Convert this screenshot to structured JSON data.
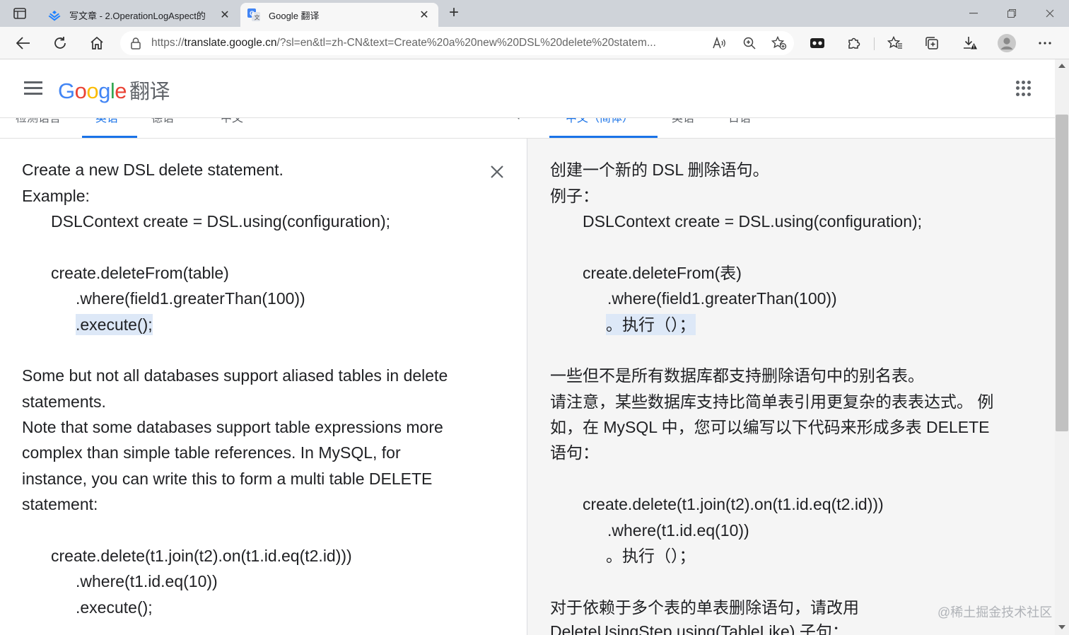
{
  "browser": {
    "tabs": [
      {
        "title": "写文章 - 2.OperationLogAspect的",
        "active": false
      },
      {
        "title": "Google 翻译",
        "active": true
      }
    ],
    "new_tab": "+",
    "url_prefix": "https://",
    "url_host": "translate.google.cn",
    "url_rest": "/?sl=en&tl=zh-CN&text=Create%20a%20new%20DSL%20delete%20statem..."
  },
  "header": {
    "logo": [
      "G",
      "o",
      "o",
      "g",
      "l",
      "e"
    ],
    "product": "翻译"
  },
  "language_bar": {
    "source_languages": [
      "检测语言",
      "英语",
      "德语",
      "中文"
    ],
    "target_languages": [
      "中文（简体）",
      "英语",
      "日语"
    ]
  },
  "source": {
    "lines": [
      "Create a new DSL delete statement.",
      "Example:",
      "DSLContext create = DSL.using(configuration);",
      "create.deleteFrom(table)",
      ".where(field1.greaterThan(100))",
      ".execute();",
      "Some but not all databases support aliased tables in delete",
      "statements.",
      "Note that some databases support table expressions more",
      "complex than simple table references. In MySQL, for",
      "instance, you can write this to form a multi table DELETE",
      "statement:",
      "create.delete(t1.join(t2).on(t1.id.eq(t2.id)))",
      ".where(t1.id.eq(10))",
      ".execute();"
    ]
  },
  "translation": {
    "lines": [
      "创建一个新的 DSL 删除语句。",
      "例子：",
      "DSLContext create = DSL.using(configuration);",
      "create.deleteFrom(表)",
      ".where(field1.greaterThan(100))",
      "。执行（）；",
      "一些但不是所有数据库都支持删除语句中的别名表。",
      "请注意，某些数据库支持比简单表引用更复杂的表表达式。 例",
      "如，在 MySQL 中，您可以编写以下代码来形成多表 DELETE",
      "语句：",
      "create.delete(t1.join(t2).on(t1.id.eq(t2.id)))",
      ".where(t1.id.eq(10))",
      "。执行（）；",
      "对于依赖于多个表的单表删除语句，请改用",
      "DeleteUsingStep.using(TableLike) 子句："
    ]
  },
  "watermark": "@稀土掘金技术社区",
  "colors": {
    "accent": "#1a73e8",
    "highlight": "#dde8f7",
    "translation_bg": "#f5f5f5"
  }
}
